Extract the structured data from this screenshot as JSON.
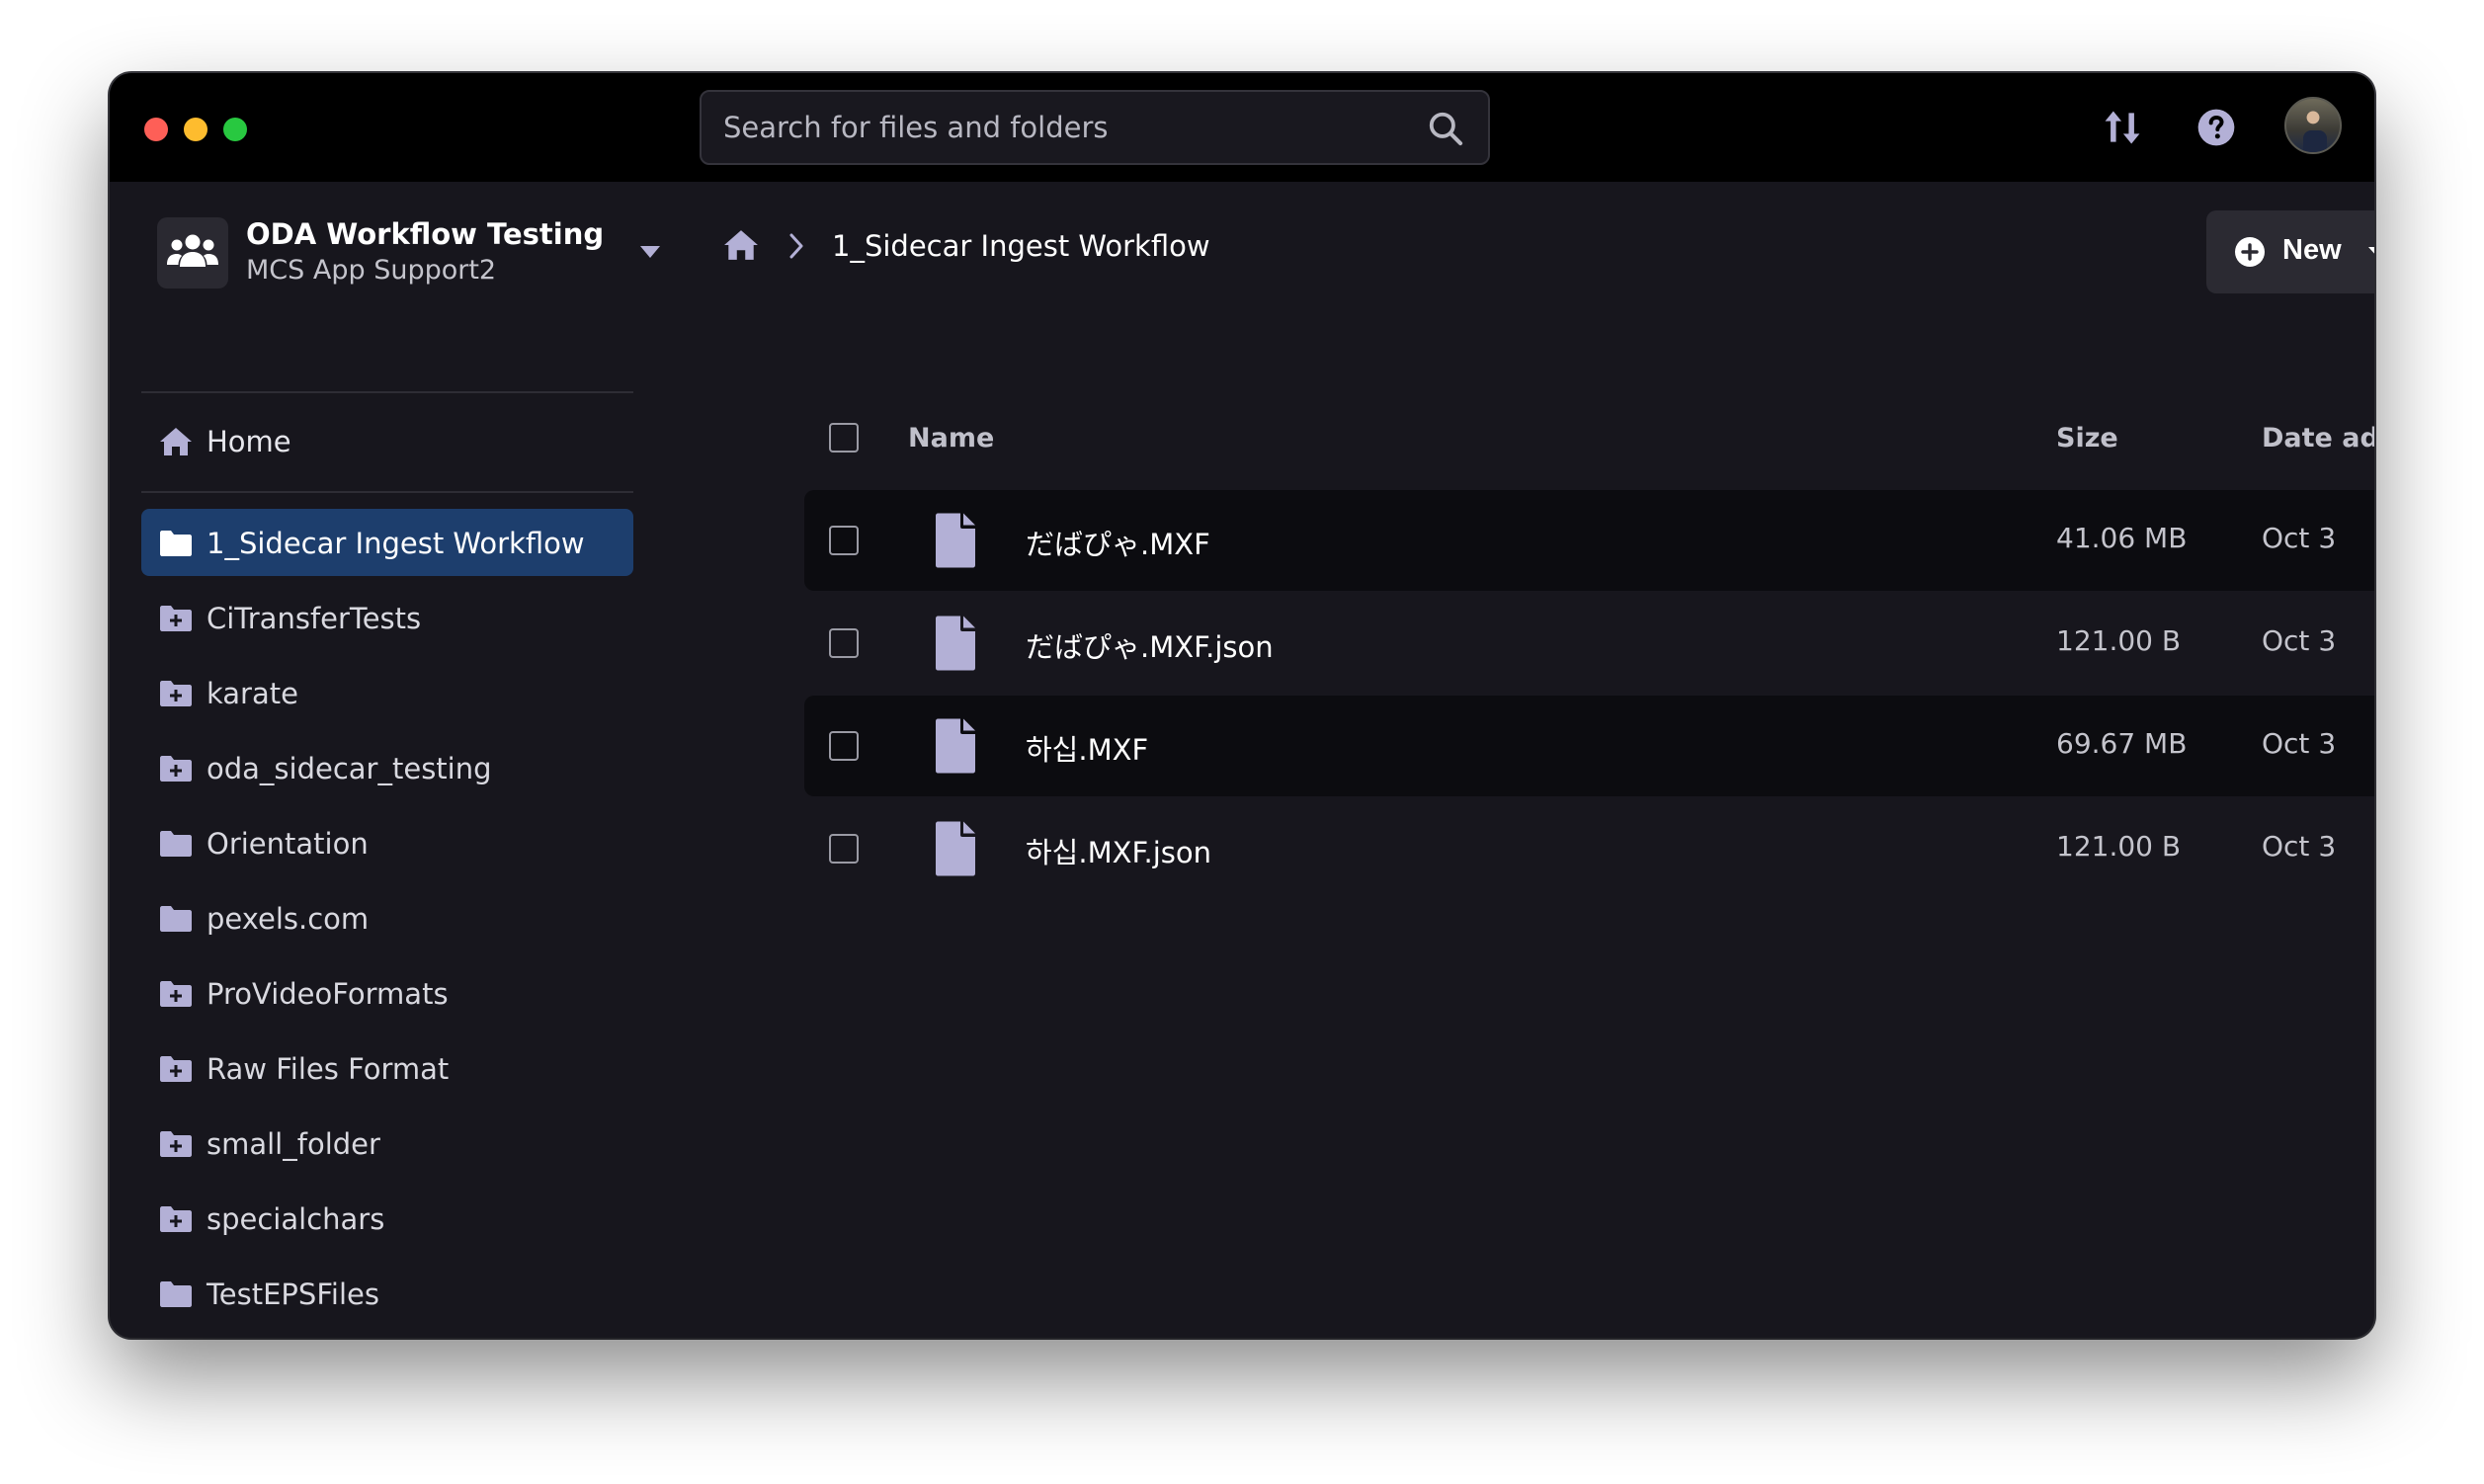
{
  "search": {
    "placeholder": "Search for files and folders"
  },
  "workspace": {
    "name": "ODA Workflow Testing",
    "subtitle": "MCS App Support2"
  },
  "sidebar": {
    "home_label": "Home",
    "items": [
      {
        "label": "1_Sidecar Ingest Workflow",
        "icon": "folder-icon",
        "active": true
      },
      {
        "label": "CiTransferTests",
        "icon": "folder-plus-icon"
      },
      {
        "label": "karate",
        "icon": "folder-plus-icon"
      },
      {
        "label": "oda_sidecar_testing",
        "icon": "folder-plus-icon"
      },
      {
        "label": "Orientation",
        "icon": "folder-icon"
      },
      {
        "label": "pexels.com",
        "icon": "folder-icon"
      },
      {
        "label": "ProVideoFormats",
        "icon": "folder-plus-icon"
      },
      {
        "label": "Raw Files Format",
        "icon": "folder-plus-icon"
      },
      {
        "label": "small_folder",
        "icon": "folder-plus-icon"
      },
      {
        "label": "specialchars",
        "icon": "folder-plus-icon"
      },
      {
        "label": "TestEPSFiles",
        "icon": "folder-icon"
      }
    ]
  },
  "breadcrumb": {
    "current": "1_Sidecar Ingest Workflow"
  },
  "toolbar": {
    "new_label": "New"
  },
  "table": {
    "columns": {
      "name": "Name",
      "size": "Size",
      "date": "Date added"
    },
    "rows": [
      {
        "name": "だばぴゃ.MXF",
        "size": "41.06 MB",
        "date": "Oct 3"
      },
      {
        "name": "だばぴゃ.MXF.json",
        "size": "121.00 B",
        "date": "Oct 3"
      },
      {
        "name": "하십.MXF",
        "size": "69.67 MB",
        "date": "Oct 3"
      },
      {
        "name": "하십.MXF.json",
        "size": "121.00 B",
        "date": "Oct 3"
      }
    ]
  },
  "colors": {
    "window_bg": "#17161d",
    "titlebar_bg": "#000000",
    "active_item": "#1d3e6d",
    "icon_lavender": "#b3b0d6"
  }
}
